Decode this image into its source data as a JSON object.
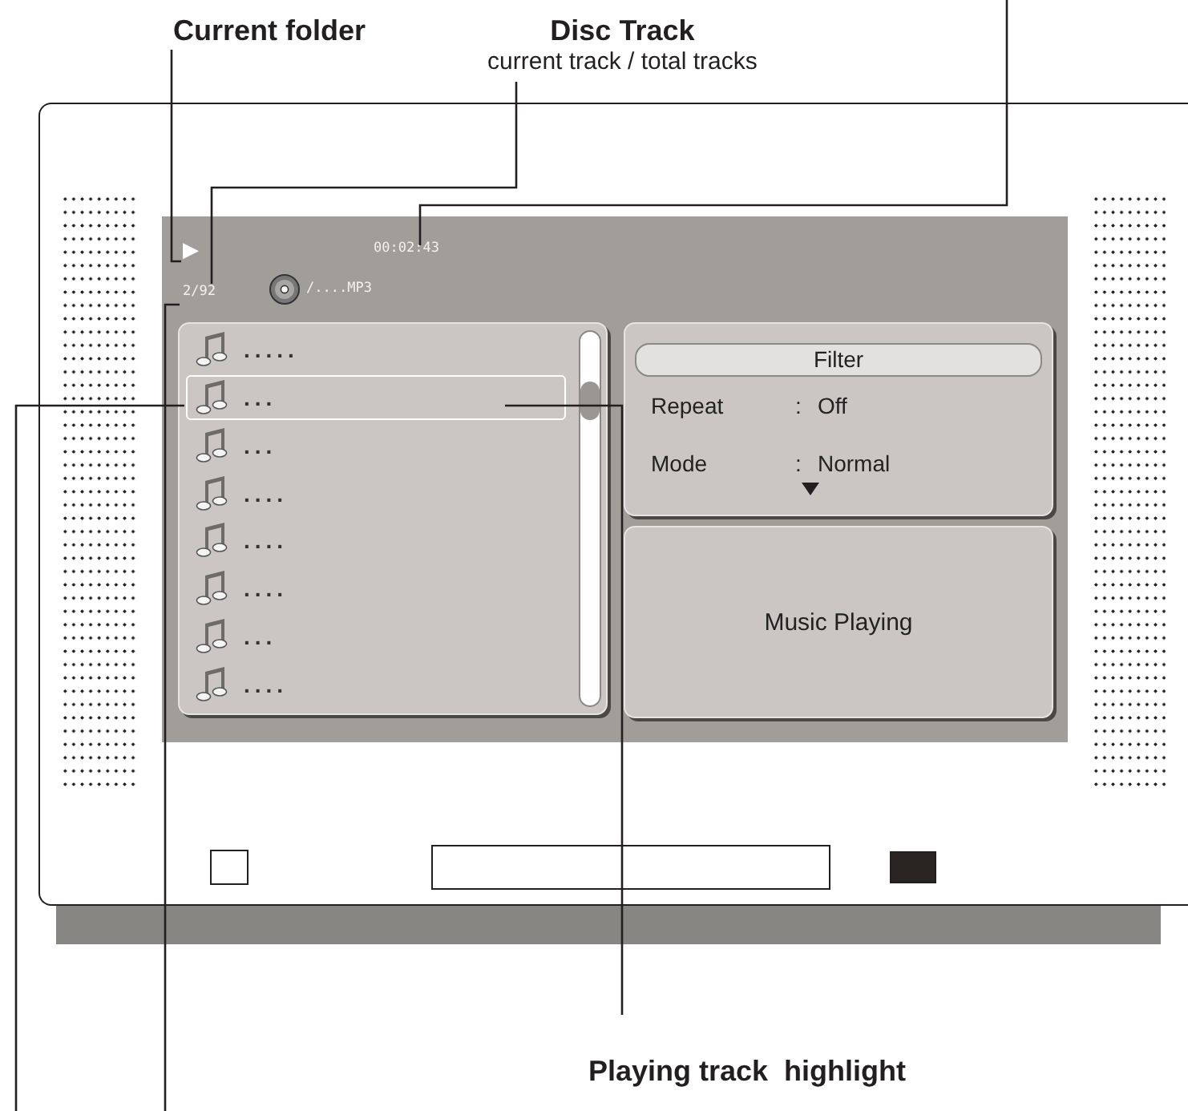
{
  "callouts": {
    "current_folder": "Current folder",
    "disc_track": "Disc Track",
    "disc_track_note": "current track / total tracks",
    "playing_highlight": "Playing track  highlight"
  },
  "screen": {
    "play_symbol": "▶",
    "time": "00:02:43",
    "track_count": "2/92",
    "folder_path": "/....MP3",
    "tracks": [
      {
        "name": ".....",
        "selected": false
      },
      {
        "name": "...",
        "selected": true
      },
      {
        "name": "...",
        "selected": false
      },
      {
        "name": "....",
        "selected": false
      },
      {
        "name": "....",
        "selected": false
      },
      {
        "name": "....",
        "selected": false
      },
      {
        "name": "...",
        "selected": false
      },
      {
        "name": "....",
        "selected": false
      }
    ],
    "filter": {
      "title": "Filter",
      "settings": [
        {
          "label": "Repeat",
          "separator": ":",
          "value": "Off"
        },
        {
          "label": "Mode",
          "separator": ":",
          "value": "Normal"
        }
      ]
    },
    "message": "Music Playing"
  }
}
